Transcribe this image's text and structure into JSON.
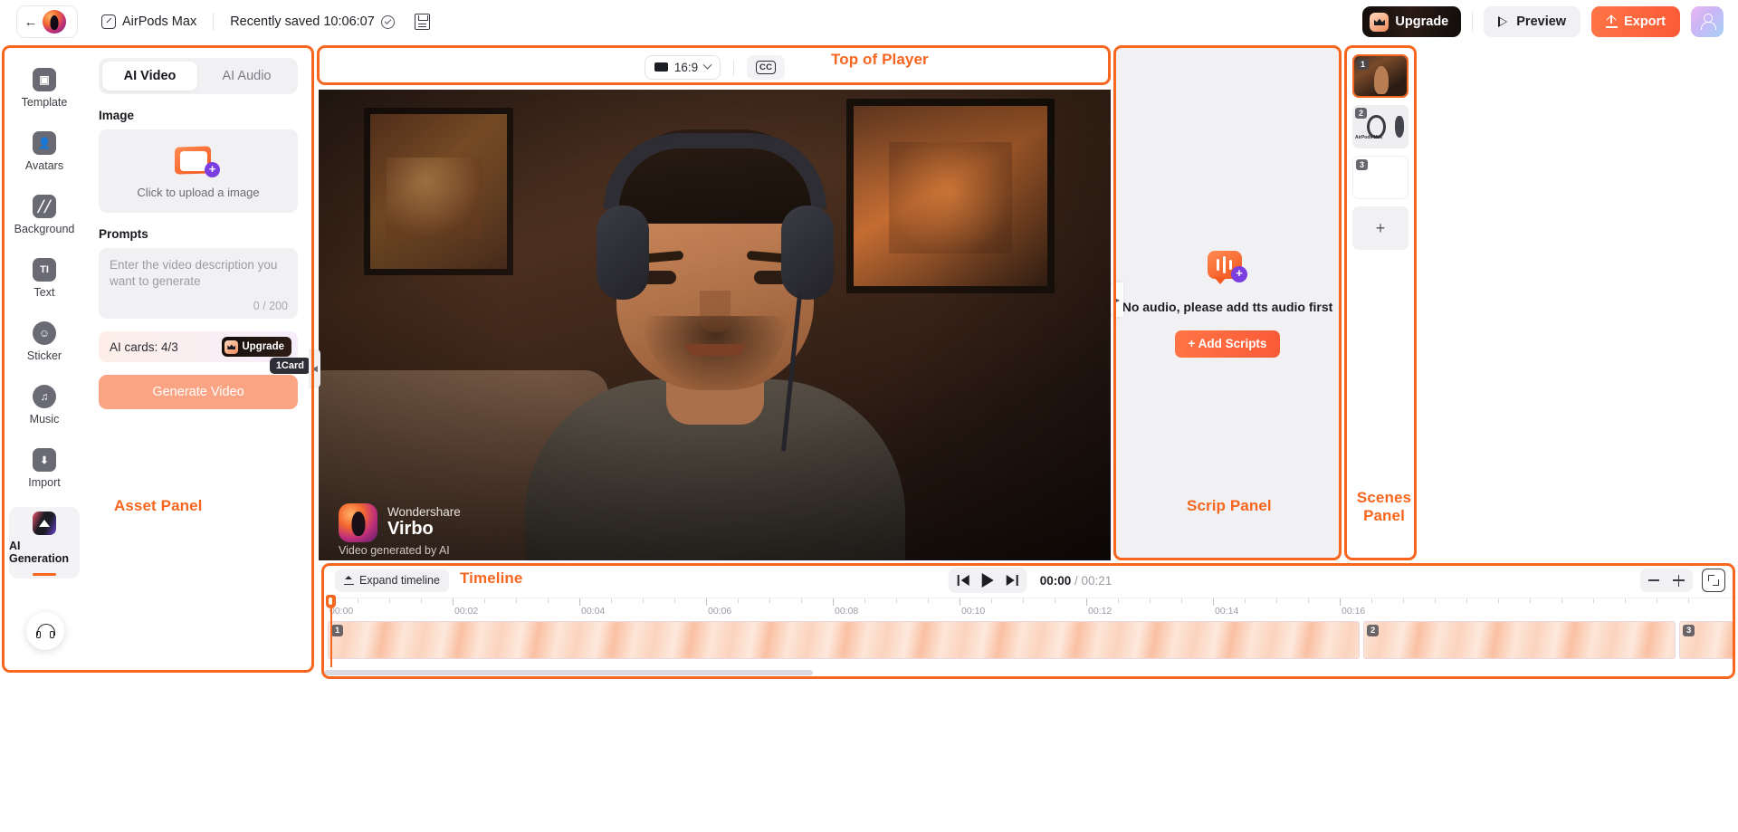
{
  "header": {
    "back_icon": "back-arrow-icon",
    "brand_icon": "virbo-logo-icon",
    "project_name": "AirPods Max",
    "edit_icon": "pencil-icon",
    "saved_status": "Recently saved 10:06:07",
    "saved_check_icon": "check-circle-icon",
    "save_icon": "save-disk-icon",
    "upgrade_label": "Upgrade",
    "upgrade_icon": "crown-icon",
    "preview_label": "Preview",
    "preview_icon": "play-outline-icon",
    "export_label": "Export",
    "export_icon": "upload-arrow-icon",
    "avatar_icon": "user-avatar-icon"
  },
  "annotations": [
    {
      "label": "Asset Panel"
    },
    {
      "label": "Top of Player"
    },
    {
      "label": "Scrip Panel"
    },
    {
      "label": "Scenes Panel"
    },
    {
      "label": "Timeline"
    }
  ],
  "annotation_labels": {
    "asset_panel": "Asset Panel",
    "top_of_player": "Top of Player",
    "script_panel": "Scrip Panel",
    "scenes_panel": "Scenes\nPanel",
    "scenes_panel_line1": "Scenes",
    "scenes_panel_line2": "Panel",
    "timeline": "Timeline"
  },
  "sidebar": {
    "items": [
      {
        "label": "Template",
        "icon": "template-icon",
        "glyph": "▣",
        "active": false
      },
      {
        "label": "Avatars",
        "icon": "avatars-icon",
        "glyph": "☺",
        "active": false
      },
      {
        "label": "Background",
        "icon": "background-icon",
        "glyph": "╱",
        "active": false
      },
      {
        "label": "Text",
        "icon": "text-icon",
        "glyph": "TI",
        "active": false
      },
      {
        "label": "Sticker",
        "icon": "sticker-icon",
        "glyph": "☻",
        "active": false
      },
      {
        "label": "Music",
        "icon": "music-icon",
        "glyph": "♫",
        "active": false
      },
      {
        "label": "Import",
        "icon": "import-icon",
        "glyph": "⬇",
        "active": false
      },
      {
        "label": "AI Generation",
        "icon": "ai-generation-icon",
        "glyph": "",
        "active": true
      }
    ],
    "support_icon": "headset-support-icon"
  },
  "asset_panel": {
    "tabs": [
      {
        "label": "AI Video",
        "active": true
      },
      {
        "label": "AI Audio",
        "active": false
      }
    ],
    "image_section_title": "Image",
    "upload_text": "Click to upload a image",
    "upload_icon": "image-upload-icon",
    "prompts_section_title": "Prompts",
    "prompt_placeholder": "Enter the video description you want to generate",
    "prompt_value": "",
    "prompt_counter": "0 / 200",
    "ai_cards_text": "AI cards: 4/3",
    "cards_upgrade_label": "Upgrade",
    "generate_label": "Generate Video",
    "generate_cost_badge": "1Card",
    "collapse_icon": "chevron-left-icon"
  },
  "player": {
    "aspect_ratio": "16:9",
    "aspect_icon": "screen-icon",
    "chevron_icon": "chevron-down-icon",
    "cc_label": "CC",
    "watermark": {
      "brand": "Wondershare",
      "product": "Virbo",
      "note": "Video generated by AI"
    }
  },
  "script_panel": {
    "icon": "tts-audio-icon",
    "empty_message": "No audio, please add tts audio first",
    "add_scripts_label": "+ Add Scripts",
    "handle_icon": "collapse-handle-icon"
  },
  "scenes_panel": {
    "scenes": [
      {
        "number": "1",
        "selected": true
      },
      {
        "number": "2",
        "selected": false
      },
      {
        "number": "3",
        "selected": false
      }
    ],
    "add_label": "+",
    "add_icon": "plus-icon"
  },
  "timeline": {
    "expand_label": "Expand timeline",
    "expand_icon": "expand-timeline-icon",
    "prev_icon": "skip-previous-icon",
    "play_icon": "play-icon",
    "next_icon": "skip-next-icon",
    "current_time": "00:00",
    "time_separator": " / ",
    "total_time": "00:21",
    "zoom_out_icon": "zoom-out-icon",
    "zoom_in_icon": "zoom-in-icon",
    "fullscreen_icon": "fullscreen-icon",
    "ruler_labels": [
      "00:00",
      "00:02",
      "00:04",
      "00:06",
      "00:08",
      "00:10",
      "00:12",
      "00:14",
      "00:16"
    ],
    "clips": [
      {
        "number": "1"
      },
      {
        "number": "2"
      },
      {
        "number": "3"
      }
    ]
  },
  "colors": {
    "accent": "#f7661e",
    "export": "#fb5b36",
    "panel_bg": "#f1f1f3",
    "text": "#1d1d24"
  }
}
